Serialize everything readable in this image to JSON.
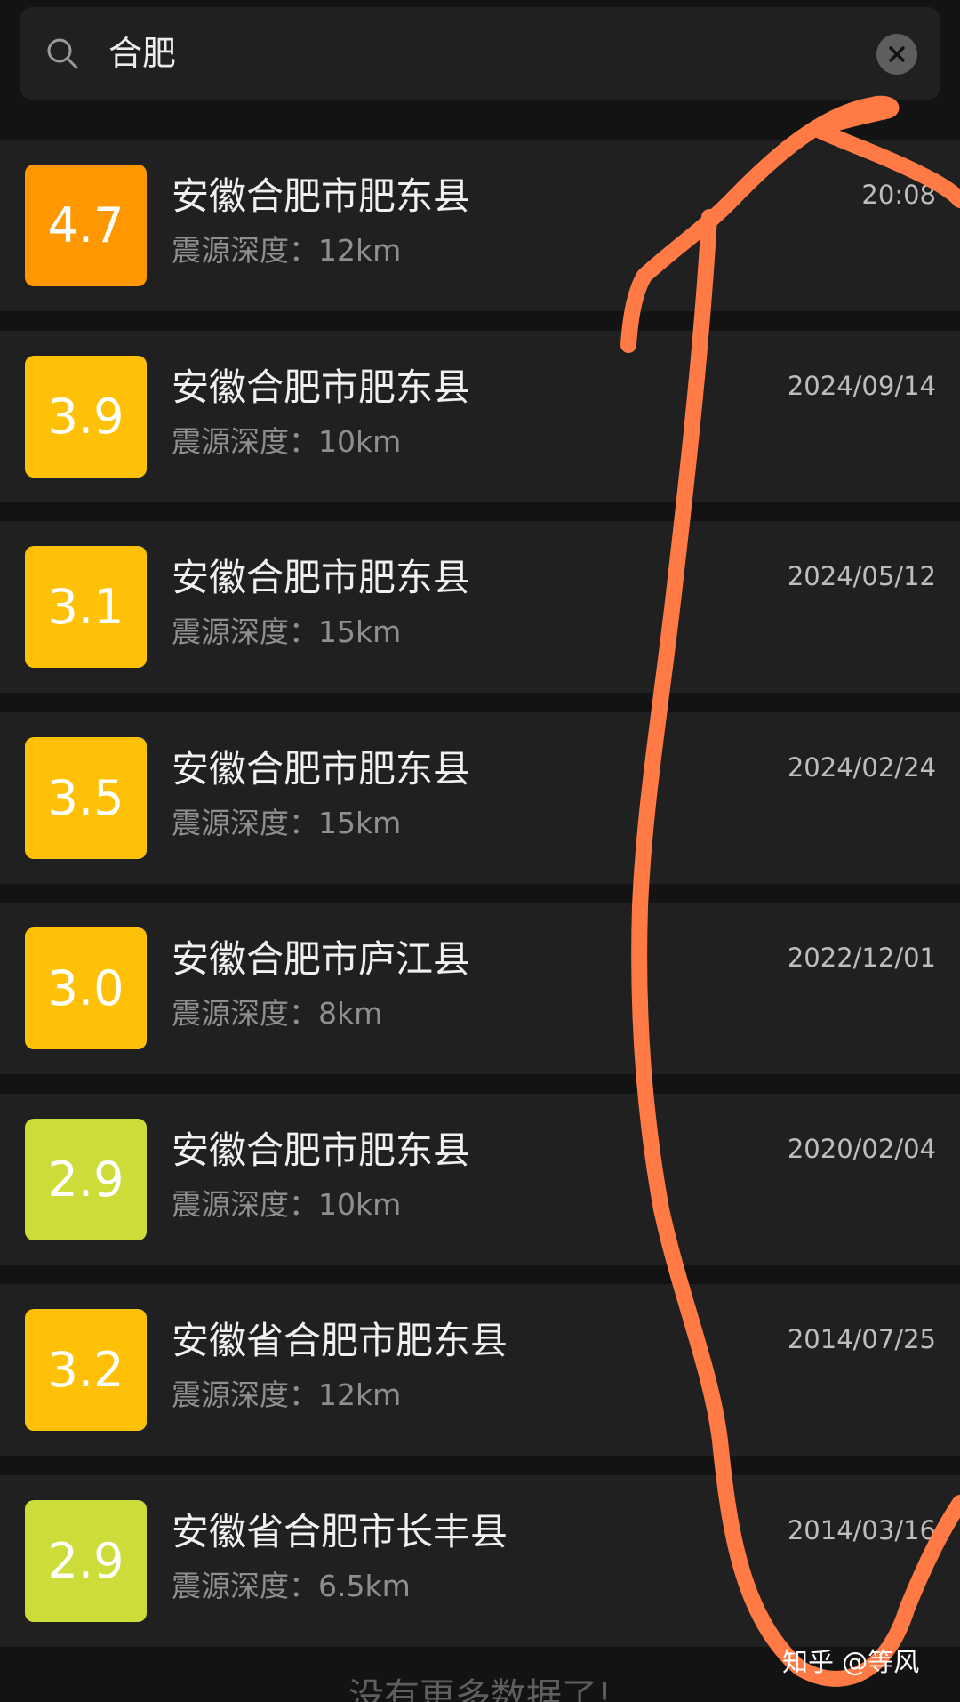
{
  "search": {
    "value": "合肥",
    "icons": {
      "search": "search-icon",
      "clear": "close-icon"
    }
  },
  "results": [
    {
      "magnitude": "4.7",
      "location": "安徽合肥市肥东县",
      "depth": "震源深度：12km",
      "time": "20:08",
      "badge_color": "#ff9800"
    },
    {
      "magnitude": "3.9",
      "location": "安徽合肥市肥东县",
      "depth": "震源深度：10km",
      "time": "2024/09/14",
      "badge_color": "#ffc107"
    },
    {
      "magnitude": "3.1",
      "location": "安徽合肥市肥东县",
      "depth": "震源深度：15km",
      "time": "2024/05/12",
      "badge_color": "#ffc107"
    },
    {
      "magnitude": "3.5",
      "location": "安徽合肥市肥东县",
      "depth": "震源深度：15km",
      "time": "2024/02/24",
      "badge_color": "#ffc107"
    },
    {
      "magnitude": "3.0",
      "location": "安徽合肥市庐江县",
      "depth": "震源深度：8km",
      "time": "2022/12/01",
      "badge_color": "#ffc107"
    },
    {
      "magnitude": "2.9",
      "location": "安徽合肥市肥东县",
      "depth": "震源深度：10km",
      "time": "2020/02/04",
      "badge_color": "#cddc39"
    },
    {
      "magnitude": "3.2",
      "location": "安徽省合肥市肥东县",
      "depth": "震源深度：12km",
      "time": "2014/07/25",
      "badge_color": "#ffc107"
    },
    {
      "magnitude": "2.9",
      "location": "安徽省合肥市长丰县",
      "depth": "震源深度：6.5km",
      "time": "2014/03/16",
      "badge_color": "#cddc39"
    }
  ],
  "footer": {
    "text": "没有更多数据了!"
  },
  "watermark": {
    "text": "知乎 @等风"
  },
  "colors": {
    "background": "#131313",
    "row": "#202020",
    "annotation_stroke": "#ff7a45"
  }
}
